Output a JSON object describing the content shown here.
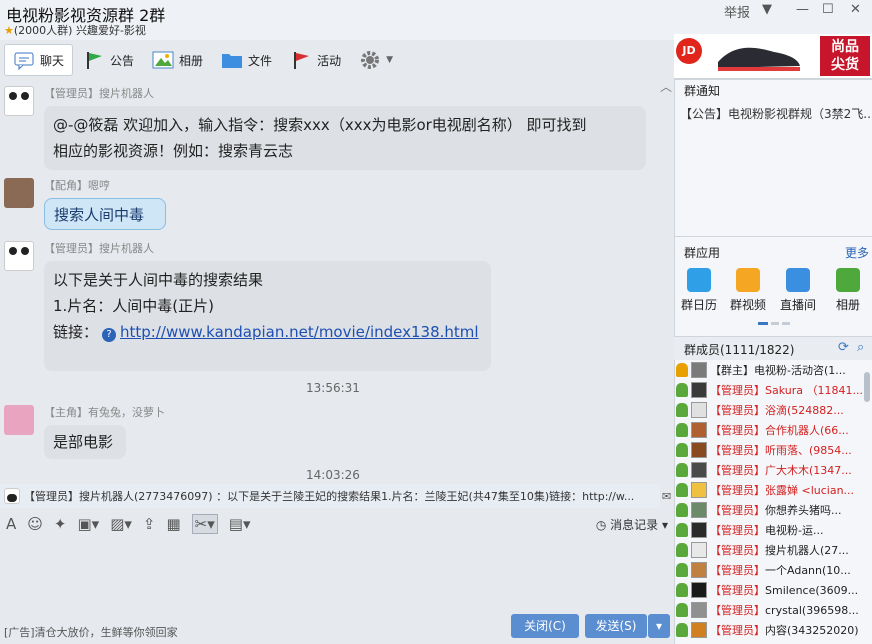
{
  "window": {
    "title": "电视粉影视资源群 2群",
    "subtitle": "(2000人群) 兴趣爱好-影视",
    "report": "举报"
  },
  "tabs": [
    {
      "label": "聊天",
      "icon": "chat-icon"
    },
    {
      "label": "公告",
      "icon": "flag-icon"
    },
    {
      "label": "相册",
      "icon": "photo-icon"
    },
    {
      "label": "文件",
      "icon": "folder-icon"
    },
    {
      "label": "活动",
      "icon": "red-flag-icon"
    }
  ],
  "messages": [
    {
      "sender": "【管理员】搜片机器人",
      "lines": [
        "@-@筱磊  欢迎加入，输入指令：搜索xxx（xxx为电影or电视剧名称） 即可找到",
        "相应的影视资源！例如：搜索青云志"
      ]
    },
    {
      "sender": "【配角】嗯哼",
      "text": "搜索人间中毒"
    },
    {
      "sender": "【管理员】搜片机器人",
      "lines": [
        "以下是关于人间中毒的搜索结果",
        "1.片名：人间中毒(正片)"
      ],
      "link_label": "链接：",
      "link": "http://www.kandapian.net/movie/index138.html"
    },
    {
      "sender": "【主角】有兔兔，没萝卜",
      "text": "是部电影"
    }
  ],
  "timestamps": [
    "13:56:31",
    "14:03:26"
  ],
  "notice_bar": "【管理员】搜片机器人(2773476097) ：以下是关于兰陵王妃的搜索结果1.片名：兰陵王妃(共47集至10集)链接：http://w...",
  "history_label": "消息记录",
  "ad_bottom": "[广告]清仓大放价，生鲜等你领回家",
  "buttons": {
    "close": "关闭(C)",
    "send": "发送(S)"
  },
  "right": {
    "ad_label": "尚品\n尖货",
    "ad_brand": "JD",
    "notice_title": "群通知",
    "notice_text": "【公告】电视粉影视群规（3禁2飞...",
    "apps_title": "群应用",
    "apps_more": "更多",
    "apps": [
      "群日历",
      "群视频",
      "直播间",
      "相册"
    ],
    "members_title": "群成员(1111/1822)",
    "members": [
      {
        "role": "【群主】",
        "name": "电视粉-活动咨(1...",
        "red": false
      },
      {
        "role": "【管理员】",
        "name": "Sakura （11841...",
        "red": true
      },
      {
        "role": "【管理员】",
        "name": "浴滴(524882...",
        "red": true
      },
      {
        "role": "【管理员】",
        "name": "合作机器人(66...",
        "red": true
      },
      {
        "role": "【管理员】",
        "name": "听雨落、(9854...",
        "red": true
      },
      {
        "role": "【管理员】",
        "name": "广大木木(1347...",
        "red": true
      },
      {
        "role": "【管理员】",
        "name": "张露婵 <lucian...",
        "red": true
      },
      {
        "role": "【管理员】",
        "name": "你想养头猪吗...",
        "red": false
      },
      {
        "role": "【管理员】",
        "name": "电视粉-运...",
        "red": false
      },
      {
        "role": "【管理员】",
        "name": "搜片机器人(27...",
        "red": false
      },
      {
        "role": "【管理员】",
        "name": "一个Adann(10...",
        "red": false
      },
      {
        "role": "【管理员】",
        "name": "Smilence(3609...",
        "red": false
      },
      {
        "role": "【管理员】",
        "name": "crystal(396598...",
        "red": false
      },
      {
        "role": "【管理员】",
        "name": "内容(343252020)",
        "red": false
      }
    ]
  },
  "colors": {
    "accent": "#5b8ed0",
    "admin_red": "#d42020"
  }
}
